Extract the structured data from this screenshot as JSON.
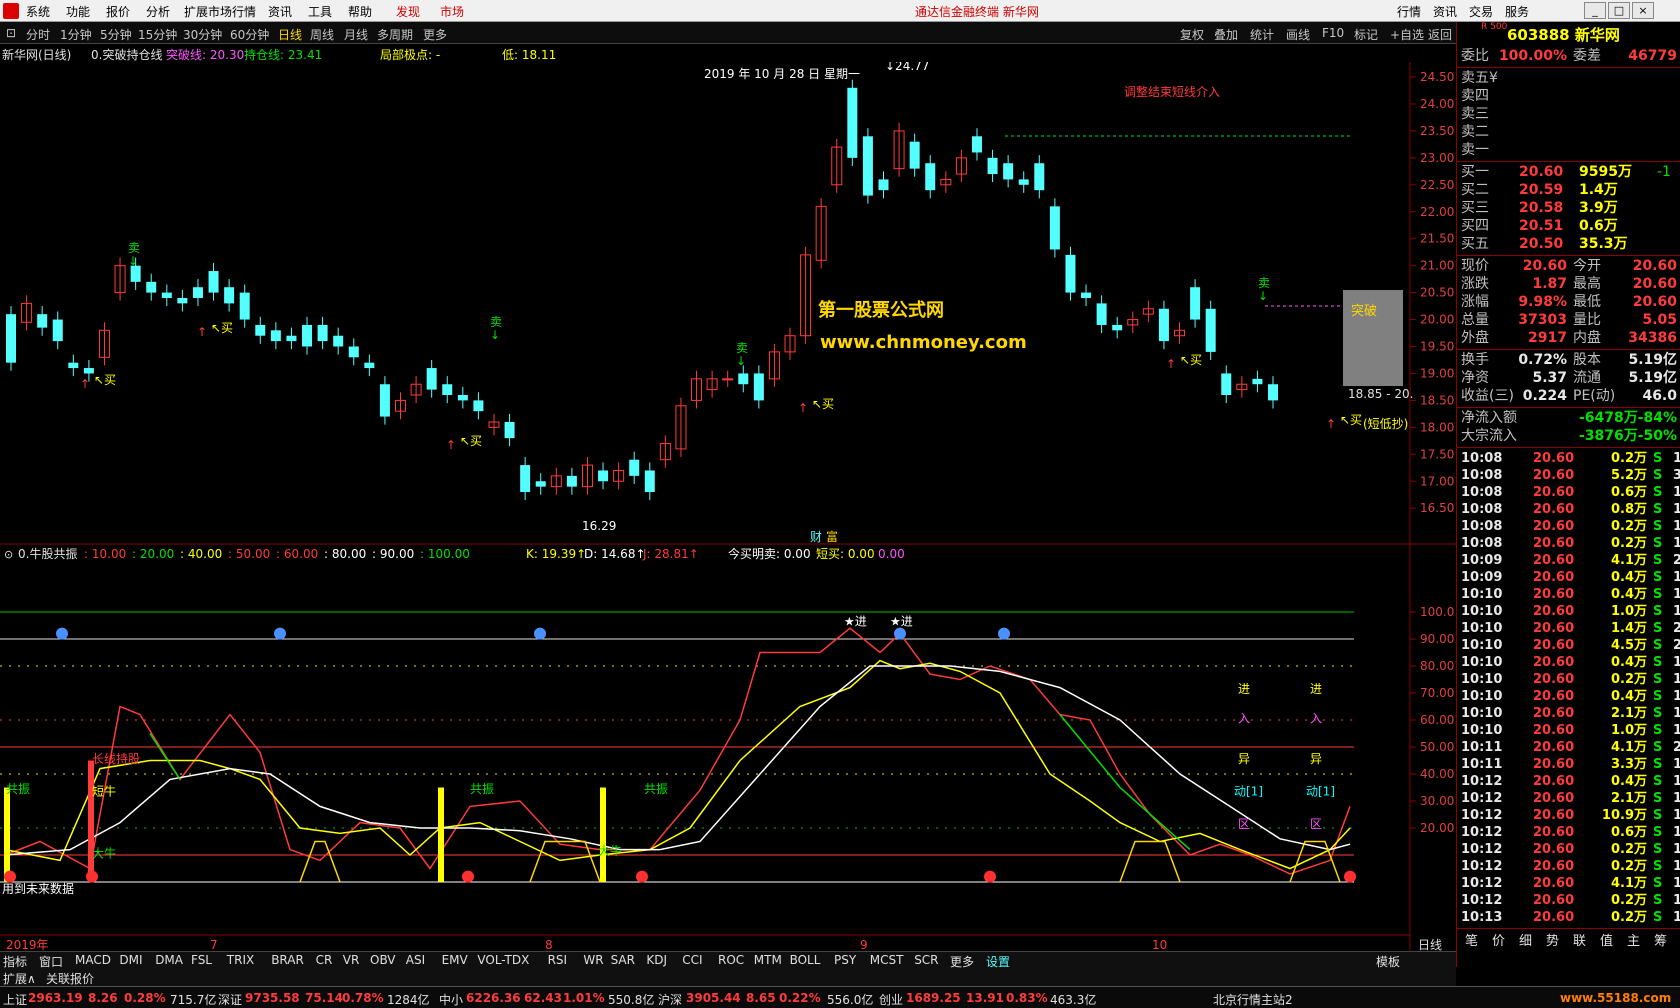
{
  "menubar": {
    "items": [
      "系统",
      "功能",
      "报价",
      "分析",
      "扩展市场行情",
      "资讯",
      "工具",
      "帮助"
    ],
    "red_items": [
      "发现",
      "市场"
    ],
    "title": "通达信金融终端  新华网",
    "right": [
      "行情",
      "资讯",
      "交易",
      "服务"
    ]
  },
  "toolbar": {
    "periods": [
      "分时",
      "1分钟",
      "5分钟",
      "15分钟",
      "30分钟",
      "60分钟",
      "日线",
      "周线",
      "月线",
      "多周期",
      "更多"
    ],
    "active": "日线",
    "right": [
      "复权",
      "叠加",
      "统计",
      "画线",
      "F10",
      "标记",
      "+自选",
      "返回"
    ]
  },
  "info": {
    "stock": "新华网(日线)",
    "formula": "0.突破持仓线",
    "breakthrough": "突破线: 20.30",
    "hold": "持仓线: 23.41",
    "extreme": "局部极点: -",
    "low": "低: 18.11"
  },
  "chart": {
    "date_label": "2019 年 10 月 28 日 星期一",
    "high_label": "24.77",
    "annot_red": "调整结束短线介入",
    "watermark1": "第一股票公式网",
    "watermark2": "www.chnmoney.com",
    "breakout": "突破",
    "range": "18.85 - 20.",
    "short_low": "(短低抄)",
    "low_label": "16.29",
    "ticks": [
      "24.50",
      "24.00",
      "23.50",
      "23.00",
      "22.50",
      "22.00",
      "21.50",
      "21.00",
      "20.50",
      "20.00",
      "19.50",
      "19.00",
      "18.50",
      "18.00",
      "17.50",
      "17.00",
      "16.50"
    ],
    "sell": "卖",
    "buy": "买",
    "fin": "财",
    "wealth": "富"
  },
  "indicator": {
    "name": "0.牛股共振",
    "levels": [
      {
        "t": "10.00",
        "c": "#ff3b3b"
      },
      {
        "t": "20.00",
        "c": "#00e000"
      },
      {
        "t": "40.00",
        "c": "#ffff00"
      },
      {
        "t": "50.00",
        "c": "#ff3b3b"
      },
      {
        "t": "60.00",
        "c": "#ff3b3b"
      },
      {
        "t": "80.00",
        "c": "#ffffff"
      },
      {
        "t": "90.00",
        "c": "#ffffff"
      },
      {
        "t": "100.00",
        "c": "#00e000"
      }
    ],
    "k": "K: 19.39",
    "d": "D: 14.68",
    "j": "J: 28.81",
    "buy_tomorrow": "今买明卖: 0.00",
    "short_buy": "短买: 0.00",
    "last": "0.00",
    "ticks": [
      "100.0",
      "90.00",
      "80.00",
      "70.00",
      "60.00",
      "50.00",
      "40.00",
      "30.00",
      "20.00"
    ],
    "labels": {
      "gz": "共振",
      "longhold": "长线持股",
      "shortbull": "短牛",
      "bigbull": "大牛",
      "jin": "进",
      "ru": "入",
      "yi": "异",
      "dong": "动[1]",
      "qu": "区",
      "star": "★进",
      "future": "用到未来数据"
    }
  },
  "xaxis": {
    "year": "2019年",
    "m7": "7",
    "m8": "8",
    "m9": "9",
    "m10": "10",
    "daily": "日线"
  },
  "tabs": [
    "指标",
    "窗口",
    "MACD",
    "DMI",
    "DMA",
    "FSL",
    "TRIX",
    "BRAR",
    "CR",
    "VR",
    "OBV",
    "ASI",
    "EMV",
    "VOL-TDX",
    "RSI",
    "WR",
    "SAR",
    "KDJ",
    "CCI",
    "ROC",
    "MTM",
    "BOLL",
    "PSY",
    "MCST",
    "SCR",
    "更多",
    "设置"
  ],
  "tabs_right": "模板",
  "tabs2": [
    "扩展∧",
    "关联报价"
  ],
  "quote": {
    "code": "603888",
    "name": "新华网",
    "weibi_label": "委比",
    "weibi": "100.00%",
    "weicha_label": "委差",
    "weicha": "46779",
    "sell": [
      "卖五",
      "卖四",
      "卖三",
      "卖二",
      "卖一"
    ],
    "sell5": "¥",
    "buys": [
      {
        "l": "买一",
        "p": "20.60",
        "v": "9595万",
        "d": "-1"
      },
      {
        "l": "买二",
        "p": "20.59",
        "v": "1.4万",
        "d": ""
      },
      {
        "l": "买三",
        "p": "20.58",
        "v": "3.9万",
        "d": ""
      },
      {
        "l": "买四",
        "p": "20.51",
        "v": "0.6万",
        "d": ""
      },
      {
        "l": "买五",
        "p": "20.50",
        "v": "35.3万",
        "d": ""
      }
    ],
    "stats": [
      {
        "a": "现价",
        "av": "20.60",
        "b": "今开",
        "bv": "20.60"
      },
      {
        "a": "涨跌",
        "av": "1.87",
        "b": "最高",
        "bv": "20.60"
      },
      {
        "a": "涨幅",
        "av": "9.98%",
        "b": "最低",
        "bv": "20.60"
      },
      {
        "a": "总量",
        "av": "37303",
        "b": "量比",
        "bv": "5.05"
      },
      {
        "a": "外盘",
        "av": "2917",
        "b": "内盘",
        "bv": "34386"
      }
    ],
    "stats2": [
      {
        "a": "换手",
        "av": "0.72%",
        "b": "股本",
        "bv": "5.19亿"
      },
      {
        "a": "净资",
        "av": "5.37",
        "b": "流通",
        "bv": "5.19亿"
      },
      {
        "a": "收益(三)",
        "av": "0.224",
        "b": "PE(动)",
        "bv": "46.0"
      }
    ],
    "flow": [
      {
        "a": "净流入额",
        "v": "-6478万",
        "p": "-84%"
      },
      {
        "a": "大宗流入",
        "v": "-3876万",
        "p": "-50%"
      }
    ],
    "ticks": [
      [
        "10:08",
        "20.60",
        "0.2万",
        "S",
        "1"
      ],
      [
        "10:08",
        "20.60",
        "5.2万",
        "S",
        "3"
      ],
      [
        "10:08",
        "20.60",
        "0.6万",
        "S",
        "1"
      ],
      [
        "10:08",
        "20.60",
        "0.8万",
        "S",
        "1"
      ],
      [
        "10:08",
        "20.60",
        "0.2万",
        "S",
        "1"
      ],
      [
        "10:08",
        "20.60",
        "0.2万",
        "S",
        "1"
      ],
      [
        "10:09",
        "20.60",
        "4.1万",
        "S",
        "2"
      ],
      [
        "10:09",
        "20.60",
        "0.4万",
        "S",
        "1"
      ],
      [
        "10:10",
        "20.60",
        "0.4万",
        "S",
        "1"
      ],
      [
        "10:10",
        "20.60",
        "1.0万",
        "S",
        "1"
      ],
      [
        "10:10",
        "20.60",
        "1.4万",
        "S",
        "2"
      ],
      [
        "10:10",
        "20.60",
        "4.5万",
        "S",
        "2"
      ],
      [
        "10:10",
        "20.60",
        "0.4万",
        "S",
        "1"
      ],
      [
        "10:10",
        "20.60",
        "0.2万",
        "S",
        "1"
      ],
      [
        "10:10",
        "20.60",
        "0.4万",
        "S",
        "1"
      ],
      [
        "10:10",
        "20.60",
        "2.1万",
        "S",
        "1"
      ],
      [
        "10:10",
        "20.60",
        "1.0万",
        "S",
        "1"
      ],
      [
        "10:11",
        "20.60",
        "4.1万",
        "S",
        "2"
      ],
      [
        "10:11",
        "20.60",
        "3.3万",
        "S",
        "1"
      ],
      [
        "10:12",
        "20.60",
        "0.4万",
        "S",
        "1"
      ],
      [
        "10:12",
        "20.60",
        "2.1万",
        "S",
        "1"
      ],
      [
        "10:12",
        "20.60",
        "10.9万",
        "S",
        "1"
      ],
      [
        "10:12",
        "20.60",
        "0.6万",
        "S",
        "1"
      ],
      [
        "10:12",
        "20.60",
        "0.2万",
        "S",
        "1"
      ],
      [
        "10:12",
        "20.60",
        "0.2万",
        "S",
        "1"
      ],
      [
        "10:12",
        "20.60",
        "4.1万",
        "S",
        "1"
      ],
      [
        "10:12",
        "20.60",
        "0.2万",
        "S",
        "1"
      ],
      [
        "10:13",
        "20.60",
        "0.2万",
        "S",
        "1"
      ]
    ],
    "bottom_tabs": [
      "笔",
      "价",
      "细",
      "势",
      "联",
      "值",
      "主",
      "筹"
    ]
  },
  "status": {
    "sh": "上证",
    "sh_v": "2963.19",
    "sh_c": "8.26",
    "sh_p": "0.28%",
    "sh_a": "715.7亿",
    "sz": "深证",
    "sz_v": "9735.58",
    "sz_c": "75.14",
    "sz_p": "0.78%",
    "sz_a": "1284亿",
    "zx": "中小",
    "zx_v": "6226.36",
    "zx_c": "62.43",
    "zx_p": "1.01%",
    "zx_a": "550.8亿",
    "hs": "沪深",
    "hs_v": "3905.44",
    "hs_c": "8.65",
    "hs_p": "0.22%",
    "hs_a": "556.0亿",
    "cy": "创业",
    "cy_v": "1689.25",
    "cy_c": "13.91",
    "cy_p": "0.83%",
    "cy_a": "463.3亿",
    "server": "北京行情主站2",
    "site": "www.55188.com"
  }
}
